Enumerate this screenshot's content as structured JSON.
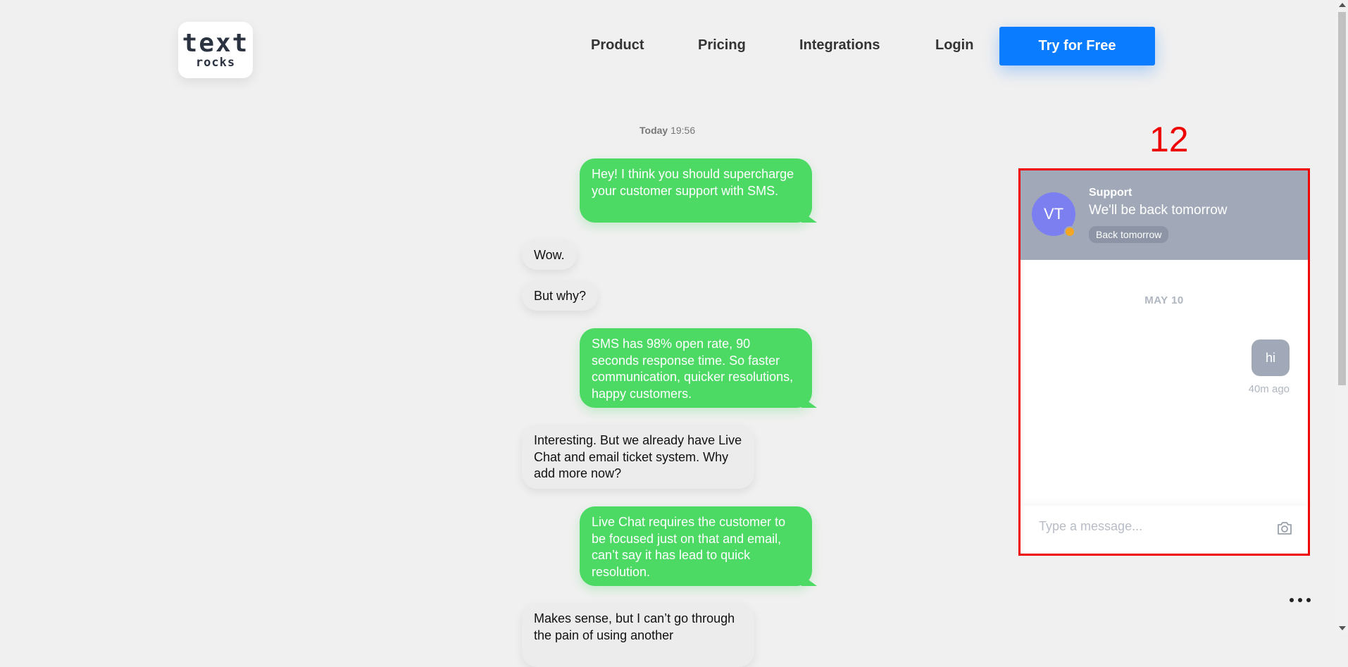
{
  "header": {
    "logo_line1": "text",
    "logo_line2": "rocks",
    "nav": [
      "Product",
      "Pricing",
      "Integrations",
      "Login"
    ],
    "cta": "Try for Free"
  },
  "conversation": {
    "timestamp_day": "Today",
    "timestamp_time": "19:56",
    "messages": [
      {
        "side": "out",
        "text": "Hey! I think you should supercharge your customer support with SMS."
      },
      {
        "side": "in",
        "text": "Wow."
      },
      {
        "side": "in",
        "text": "But why?"
      },
      {
        "side": "out",
        "text": "SMS has 98% open rate, 90 seconds response time. So faster communication, quicker resolutions, happy customers."
      },
      {
        "side": "in",
        "text": "Interesting. But we already have Live Chat and email ticket system. Why add more now?"
      },
      {
        "side": "out",
        "text": "Live Chat requires the customer to be focused just on that and email, can’t say it has lead to quick resolution."
      },
      {
        "side": "in",
        "text": "Makes sense, but I can’t go through the pain of using another"
      }
    ]
  },
  "annotation": {
    "number": "12"
  },
  "widget": {
    "avatar_initials": "VT",
    "name": "Support",
    "status": "We'll be back tomorrow",
    "badge": "Back tomorrow",
    "date_divider": "MAY 10",
    "message": "hi",
    "message_time": "40m ago",
    "input_placeholder": "Type a message..."
  },
  "colors": {
    "accent": "#0a7cff",
    "outgoing_bubble": "#4cd964",
    "incoming_bubble": "#ececec",
    "widget_header": "#a1a9b8",
    "avatar": "#7b7ff0",
    "status_dot": "#f5a623",
    "annotation": "#e00000"
  }
}
